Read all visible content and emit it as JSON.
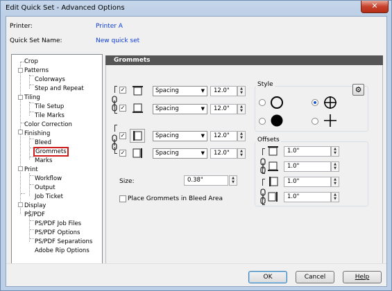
{
  "window": {
    "title": "Edit Quick Set - Advanced Options",
    "close_glyph": "✕"
  },
  "header": {
    "printer_label": "Printer:",
    "printer_value": "Printer A",
    "quickset_label": "Quick Set Name:",
    "quickset_value": "New quick set"
  },
  "tree": {
    "items": [
      {
        "label": "Crop"
      },
      {
        "label": "Patterns"
      },
      {
        "label": "Colorways"
      },
      {
        "label": "Step and Repeat"
      },
      {
        "label": "Tiling"
      },
      {
        "label": "Tile Setup"
      },
      {
        "label": "Tile Marks"
      },
      {
        "label": "Color Correction"
      },
      {
        "label": "Finishing"
      },
      {
        "label": "Bleed"
      },
      {
        "label": "Grommets"
      },
      {
        "label": "Marks"
      },
      {
        "label": "Print"
      },
      {
        "label": "Workflow"
      },
      {
        "label": "Output"
      },
      {
        "label": "Job Ticket"
      },
      {
        "label": "Display"
      },
      {
        "label": "PS/PDF"
      },
      {
        "label": "PS/PDF Job Files"
      },
      {
        "label": "PS/PDF Options"
      },
      {
        "label": "PS/PDF Separations"
      },
      {
        "label": "Adobe Rip Options"
      }
    ]
  },
  "panel": {
    "title": "Grommets",
    "rows": [
      {
        "check": "✓",
        "mode": "Spacing",
        "value": "12.0\""
      },
      {
        "check": "✓",
        "mode": "Spacing",
        "value": "12.0\""
      },
      {
        "check": "✓",
        "mode": "Spacing",
        "value": "12.0\""
      },
      {
        "check": "✓",
        "mode": "Spacing",
        "value": "12.0\""
      }
    ],
    "size_label": "Size:",
    "size_value": "0.38\"",
    "bleed_label": "Place Grommets in Bleed Area",
    "style_title": "Style",
    "offsets_title": "Offsets",
    "offsets": [
      "1.0\"",
      "1.0\"",
      "1.0\"",
      "1.0\""
    ],
    "gear_glyph": "⚙",
    "spin_up": "▲",
    "spin_down": "▼",
    "dropdown_glyph": "▼"
  },
  "footer": {
    "ok": "OK",
    "cancel": "Cancel",
    "help": "Help"
  }
}
